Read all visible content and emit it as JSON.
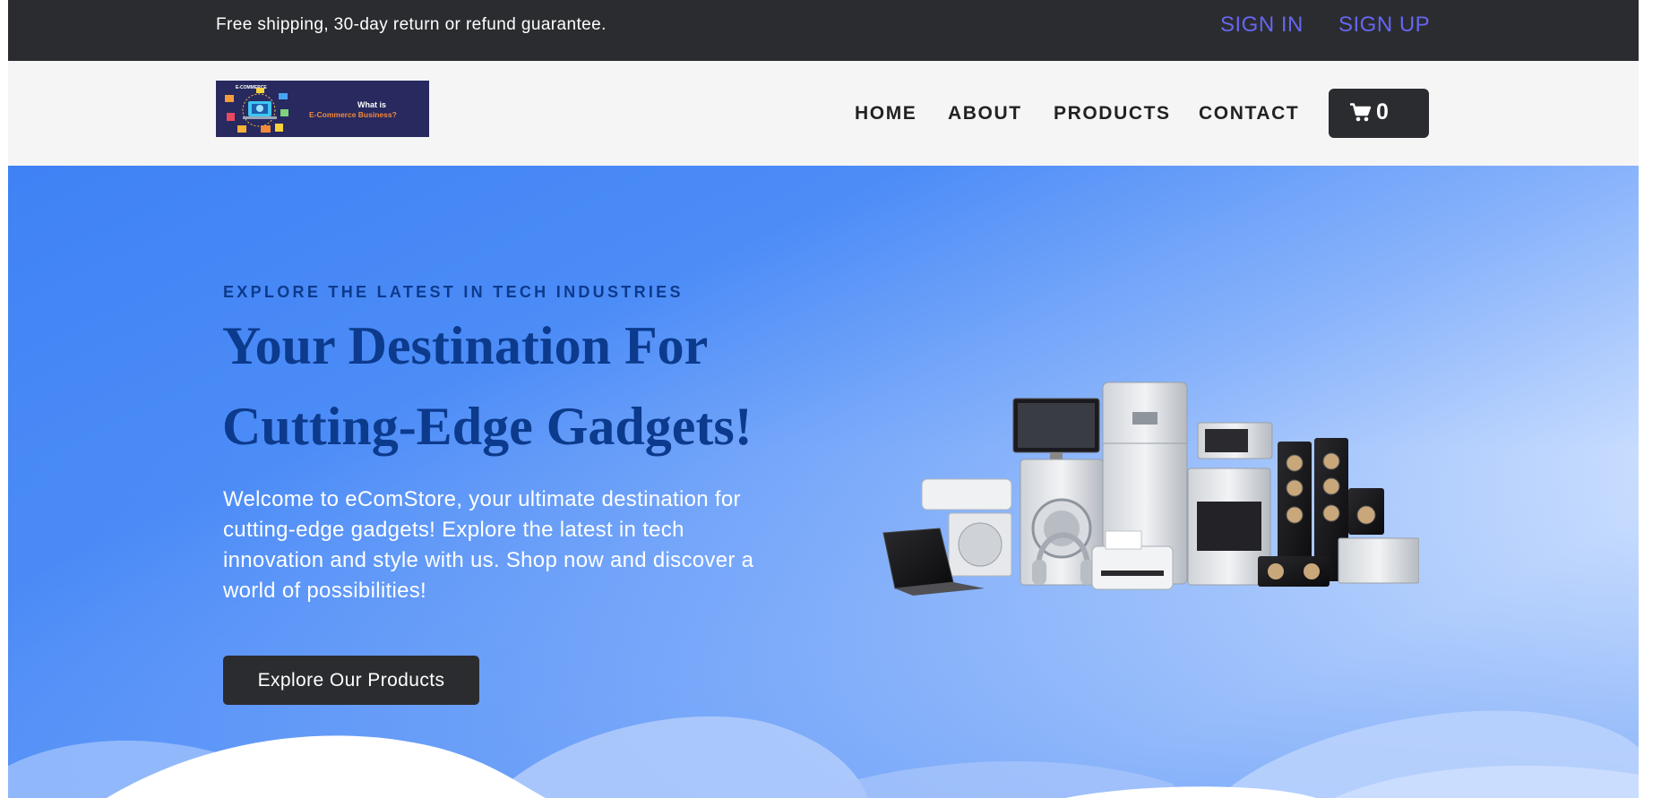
{
  "topbar": {
    "promo": "Free shipping, 30-day return or refund guarantee.",
    "sign_in": "SIGN IN",
    "sign_up": "SIGN UP"
  },
  "header": {
    "logo": {
      "badge": "E-COMMERCE",
      "line1": "What is",
      "line2": "E-Commerce Business?"
    },
    "nav": {
      "home": "HOME",
      "about": "ABOUT",
      "products": "PRODUCTS",
      "contact": "CONTACT"
    },
    "cart": {
      "icon": "cart-icon",
      "count": "0"
    }
  },
  "hero": {
    "eyebrow": "EXPLORE THE LATEST IN TECH INDUSTRIES",
    "headline": "Your Destination For Cutting-Edge Gadgets!",
    "blurb": "Welcome to eComStore, your ultimate destination for cutting-edge gadgets! Explore the latest in tech innovation and style with us. Shop now and discover a world of possibilities!",
    "cta": "Explore Our Products"
  },
  "colors": {
    "topbar_bg": "#2b2c30",
    "auth_link": "#6666f0",
    "header_bg": "#f5f5f5",
    "hero_blue": "#3f82f5",
    "headline": "#0c3a8c",
    "button_bg": "#2b2c30"
  }
}
